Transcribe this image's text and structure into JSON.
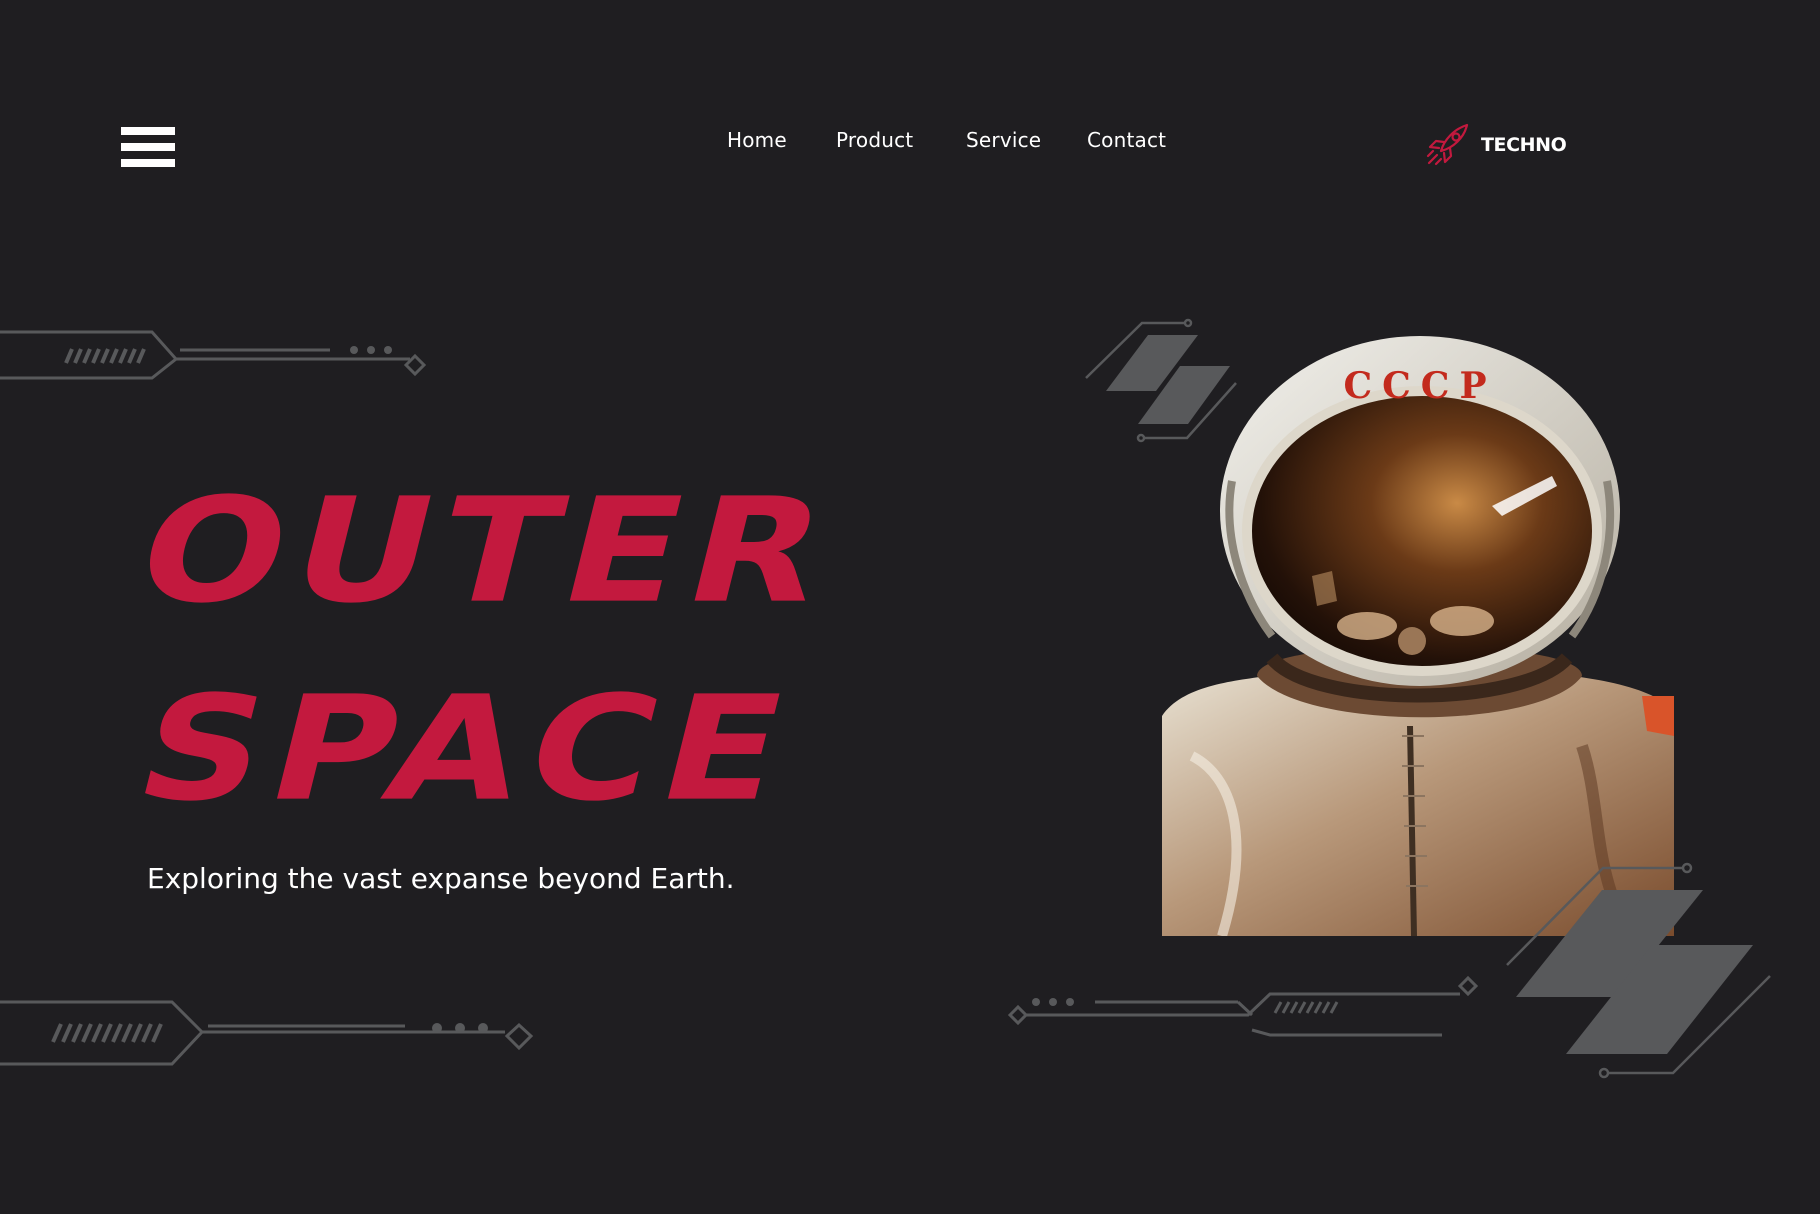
{
  "nav": {
    "links": [
      "Home",
      "Product",
      "Service",
      "Contact"
    ]
  },
  "brand": {
    "name": "TECHNO",
    "icon": "rocket-icon"
  },
  "hero": {
    "title_line1": "OUTER",
    "title_line2": "SPACE",
    "tagline": "Exploring the vast expanse beyond Earth."
  },
  "photo": {
    "helmet_text": "CCCP"
  },
  "colors": {
    "background": "#1f1e21",
    "accent": "#c3193e",
    "text": "#ffffff",
    "deco_gray": "#58595b"
  }
}
